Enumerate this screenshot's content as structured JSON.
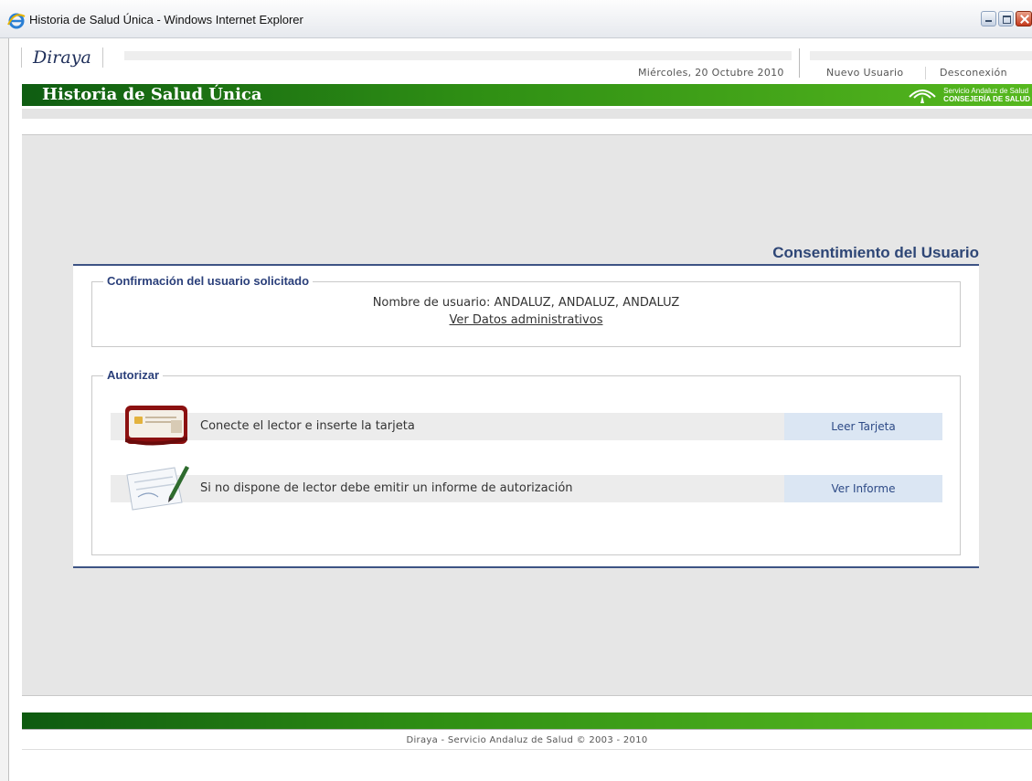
{
  "window": {
    "title": "Historia de Salud Única - Windows Internet Explorer"
  },
  "header": {
    "logo_text": "Diraya",
    "date": "Miércoles, 20 Octubre 2010",
    "nuevo_usuario": "Nuevo Usuario",
    "desconexion": "Desconexión",
    "app_title": "Historia de Salud Única",
    "sas_line1": "Servicio Andaluz de Salud",
    "sas_line2": "CONSEJERÍA DE SALUD"
  },
  "main": {
    "section_title": "Consentimiento del Usuario",
    "confirm": {
      "legend": "Confirmación del usuario solicitado",
      "user_name": "Nombre de usuario: ANDALUZ, ANDALUZ, ANDALUZ",
      "admin_link": "Ver Datos administrativos"
    },
    "authorize": {
      "legend": "Autorizar",
      "rows": [
        {
          "text": "Conecte el lector e inserte la tarjeta",
          "action": "Leer Tarjeta",
          "icon": "id-card-icon"
        },
        {
          "text": "Si no dispone de lector debe emitir un informe de autorización",
          "action": "Ver Informe",
          "icon": "document-pen-icon"
        }
      ]
    }
  },
  "footer": {
    "copyright": "Diraya - Servicio Andaluz de Salud © 2003 - 2010"
  },
  "colors": {
    "brand_green": "#2f8f14",
    "title_blue": "#2e4676",
    "action_bg": "#dbe6f3"
  }
}
